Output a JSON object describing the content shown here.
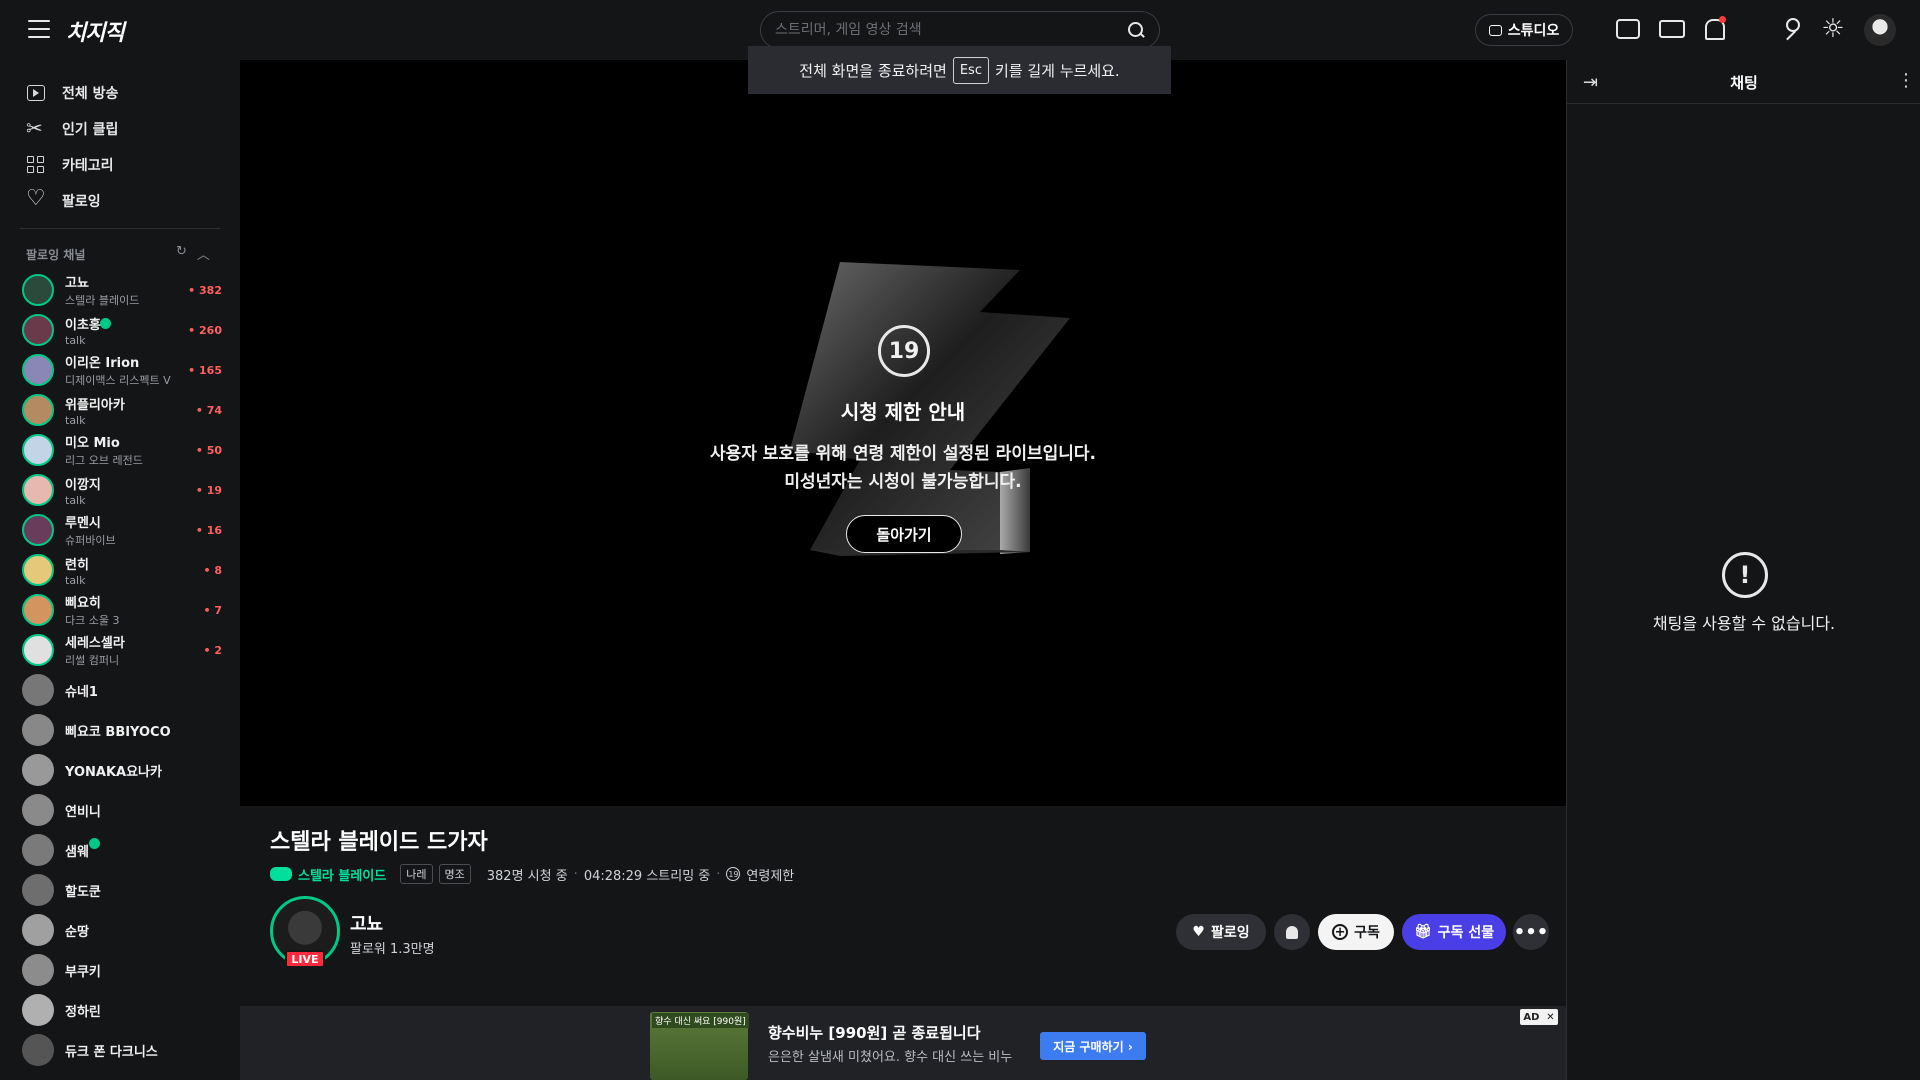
{
  "header": {
    "logo": "치지직",
    "search_placeholder": "스트리머, 게임 영상 검색",
    "studio_label": "스튜디오"
  },
  "fullscreen_toast": {
    "before": "전체 화면을 종료하려면",
    "key": "Esc",
    "after": "키를 길게 누르세요."
  },
  "sidebar": {
    "nav": [
      {
        "label": "전체 방송",
        "icon": "play-icon"
      },
      {
        "label": "인기 클립",
        "icon": "scissors-icon"
      },
      {
        "label": "카테고리",
        "icon": "grid-icon"
      },
      {
        "label": "팔로잉",
        "icon": "heart-icon"
      }
    ],
    "following_header": "팔로잉 채널",
    "channels": [
      {
        "name": "고뇨",
        "sub": "스텔라 블레이드",
        "count": "382",
        "live": true,
        "verified": false,
        "color": "#2b4a3c"
      },
      {
        "name": "이초홍",
        "sub": "talk",
        "count": "260",
        "live": true,
        "verified": true,
        "color": "#6a3a4a"
      },
      {
        "name": "이리온 Irion",
        "sub": "디제이맥스 리스펙트 V",
        "count": "165",
        "live": true,
        "verified": false,
        "color": "#8a86b5"
      },
      {
        "name": "위플리아카",
        "sub": "talk",
        "count": "74",
        "live": true,
        "verified": false,
        "color": "#b48a62"
      },
      {
        "name": "미오 Mio",
        "sub": "리그 오브 레전드",
        "count": "50",
        "live": true,
        "verified": false,
        "color": "#c2d4e6"
      },
      {
        "name": "이깡지",
        "sub": "talk",
        "count": "19",
        "live": true,
        "verified": false,
        "color": "#e6b8b0"
      },
      {
        "name": "루멘시",
        "sub": "슈퍼바이브",
        "count": "16",
        "live": true,
        "verified": false,
        "color": "#6a3c5c"
      },
      {
        "name": "련히",
        "sub": "talk",
        "count": "8",
        "live": true,
        "verified": false,
        "color": "#e6c87a"
      },
      {
        "name": "삐요히",
        "sub": "다크 소울 3",
        "count": "7",
        "live": true,
        "verified": false,
        "color": "#d49460"
      },
      {
        "name": "세레스셀라",
        "sub": "리썰 컴퍼니",
        "count": "2",
        "live": true,
        "verified": false,
        "color": "#e0e0e0"
      },
      {
        "name": "슈네1",
        "sub": "",
        "count": "",
        "live": false,
        "verified": false,
        "color": "#777"
      },
      {
        "name": "삐요코 BBIYOCO",
        "sub": "",
        "count": "",
        "live": false,
        "verified": false,
        "color": "#888"
      },
      {
        "name": "YONAKA요나카",
        "sub": "",
        "count": "",
        "live": false,
        "verified": false,
        "color": "#999"
      },
      {
        "name": "연비니",
        "sub": "",
        "count": "",
        "live": false,
        "verified": false,
        "color": "#8a8a8a"
      },
      {
        "name": "샘웨",
        "sub": "",
        "count": "",
        "live": false,
        "verified": true,
        "color": "#7a7a7a"
      },
      {
        "name": "할도쿤",
        "sub": "",
        "count": "",
        "live": false,
        "verified": false,
        "color": "#6e6e6e"
      },
      {
        "name": "순땅",
        "sub": "",
        "count": "",
        "live": false,
        "verified": false,
        "color": "#a0a0a0"
      },
      {
        "name": "부쿠키",
        "sub": "",
        "count": "",
        "live": false,
        "verified": false,
        "color": "#8c8c8c"
      },
      {
        "name": "정하린",
        "sub": "",
        "count": "",
        "live": false,
        "verified": false,
        "color": "#b0b0b0"
      },
      {
        "name": "듀크 폰 다크니스",
        "sub": "",
        "count": "",
        "live": false,
        "verified": false,
        "color": "#555"
      }
    ]
  },
  "player": {
    "age_rating": "19",
    "restrict_title": "시청 제한 안내",
    "restrict_line1": "사용자 보호를 위해 연령 제한이 설정된 라이브입니다.",
    "restrict_line2": "미성년자는 시청이 불가능합니다.",
    "back_label": "돌아가기"
  },
  "stream": {
    "title": "스텔라 블레이드 드가자",
    "category": "스텔라 블레이드",
    "tags": [
      "나레",
      "명조"
    ],
    "viewers": "382명 시청 중",
    "uptime": "04:28:29 스트리밍 중",
    "age_label": "연령제한",
    "age_mini": "19",
    "streamer": "고뇨",
    "followers": "팔로워 1.3만명",
    "live_badge": "LIVE",
    "follow_label": "팔로잉",
    "subscribe_label": "구독",
    "gift_label": "구독 선물"
  },
  "ad": {
    "image_label": "향수 대신 써요 [990원]",
    "title": "향수비누 [990원] 곧 종료됩니다",
    "desc": "은은한 살냄새 미쳤어요. 향수 대신 쓰는 비누",
    "cta": "지금 구매하기 ›",
    "badge": "AD"
  },
  "chat": {
    "title": "채팅",
    "unavailable": "채팅을 사용할 수 없습니다."
  },
  "colors": {
    "accent": "#00c986",
    "live_red": "#ff2a3d",
    "gift_purple": "#4a3ee6"
  }
}
